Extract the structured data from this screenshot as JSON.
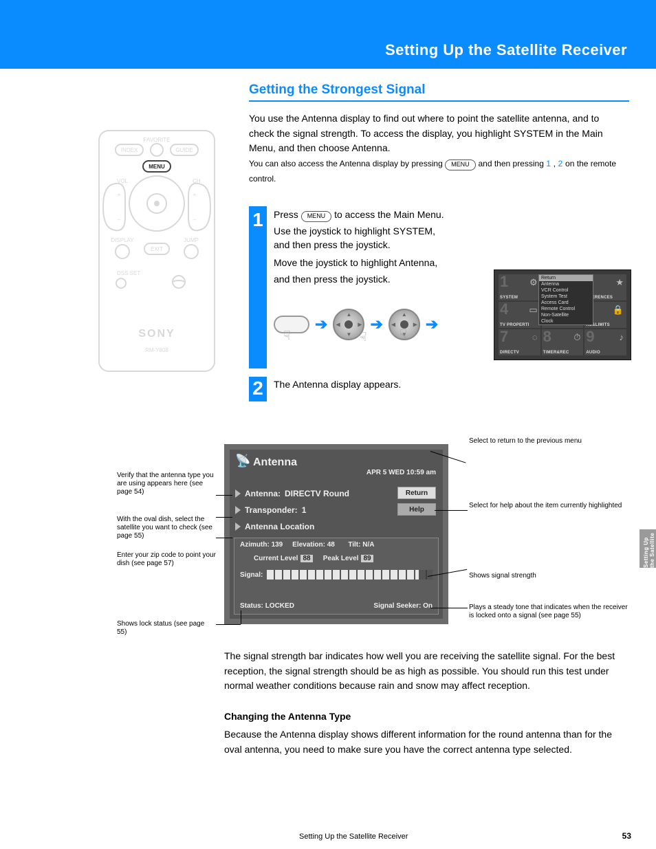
{
  "banner": {
    "title": "Setting Up the Satellite Receiver"
  },
  "section": {
    "heading": "Getting the Strongest Signal"
  },
  "intro": {
    "p1_a": "You use the Antenna display to find out where to point the satellite antenna, and to check the signal strength. To access the display, you highlight SYSTEM in the Main Menu, and then choose Antenna.",
    "p1_b": "You can also access the Antenna display by pressing ",
    "p1_menu": "MENU",
    "p1_c": " and then pressing ",
    "p1_d": " on the remote control."
  },
  "steps": {
    "s1_a": "Press       to access the Main Menu.",
    "s1_b": "Use the joystick to highlight SYSTEM,",
    "s1_c": "and then press the joystick.",
    "s1_d": "Move the joystick to highlight Antenna,",
    "s1_e": "and then press the joystick.",
    "s1_menu": "MENU",
    "num1": "1",
    "num2": "2",
    "s2_a": "The Antenna display appears."
  },
  "osd": {
    "cells": [
      {
        "num": "1",
        "label": "SYSTEM",
        "icon": "⚙"
      },
      {
        "num": "",
        "label": "",
        "icon": ""
      },
      {
        "num": "",
        "label": "EFERENCES",
        "icon": "★"
      },
      {
        "num": "4",
        "label": "TV PROPERTI",
        "icon": "▭"
      },
      {
        "num": "",
        "label": "",
        "icon": ""
      },
      {
        "num": "",
        "label": "KS&LIMITS",
        "icon": "🔒"
      },
      {
        "num": "7",
        "label": "DIRECTV",
        "icon": "◌"
      },
      {
        "num": "8",
        "label": "TIMER&REC",
        "icon": "⏱"
      },
      {
        "num": "9",
        "label": "AUDIO",
        "icon": "♪"
      }
    ],
    "popup": [
      "Return",
      "Antenna",
      "VCR Control",
      "System Test",
      "Access Card",
      "Remote Control",
      "Non-Satellite",
      "Clock"
    ],
    "popup_hi_index": 0
  },
  "antenna_window": {
    "title": "Antenna",
    "date": "APR 5 WED 10:59 am",
    "row_antenna_label": "Antenna:",
    "row_antenna_value": "DIRECTV Round",
    "row_transponder_label": "Transponder:",
    "row_transponder_value": "1",
    "row_location": "Antenna Location",
    "btn_return": "Return",
    "btn_help": "Help",
    "azimuth_label": "Azimuth:",
    "azimuth_value": "139",
    "elevation_label": "Elevation:",
    "elevation_value": "48",
    "tilt_label": "Tilt:",
    "tilt_value": "N/A",
    "current_label": "Current Level",
    "current_value": "88",
    "peak_label": "Peak Level",
    "peak_value": "89",
    "signal_label": "Signal:",
    "status_label": "Status:",
    "status_value": "LOCKED",
    "seeker_label": "Signal Seeker:",
    "seeker_value": "On"
  },
  "callouts": {
    "antenna": "Verify that the antenna type you are using appears here (see page 54)",
    "transponder": "With the oval dish, select the satellite you want to check (see page 55)",
    "location": "Enter your zip code to point your dish (see page 57)",
    "status": "Shows lock status (see page 55)",
    "return": "Select to return to the previous menu",
    "help": "Select for help about the item currently highlighted",
    "signal": "Shows signal strength",
    "seeker": "Plays a steady tone that indicates when the receiver is locked onto a signal (see page 55)"
  },
  "para1": "The signal strength bar indicates how well you are receiving the satellite signal. For the best reception, the signal strength should be as high as possible. You should run this test under normal weather conditions because rain and snow may affect reception.",
  "h_change": "Changing the Antenna Type",
  "para2": "Because the Antenna display shows different information for the round antenna than for the oval antenna, you need to make sure you have the correct antenna type selected.",
  "remote_labels": {
    "favorite": "FAVORITE",
    "index": "INDEX",
    "guide": "GUIDE",
    "menu": "MENU",
    "vol": "VOL",
    "ch": "CH",
    "display": "DISPLAY",
    "exit": "EXIT",
    "jump": "JUMP",
    "dss": "DSS SET",
    "sony": "SONY",
    "model": "RM-Y808"
  },
  "sidetab": "Setting Up the Satellite Receiver",
  "footer": {
    "text": "Setting Up the Satellite Receiver",
    "page": "53"
  }
}
